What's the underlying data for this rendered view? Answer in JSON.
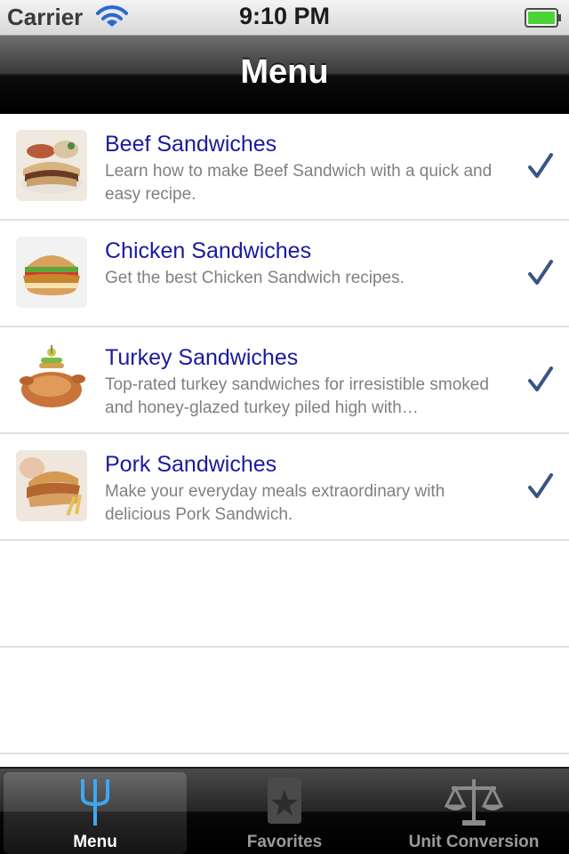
{
  "status_bar": {
    "carrier": "Carrier",
    "time": "9:10 PM"
  },
  "nav_bar": {
    "title": "Menu"
  },
  "items": [
    {
      "title": "Beef Sandwiches",
      "subtitle": "Learn how to make Beef Sandwich with a quick and easy recipe."
    },
    {
      "title": "Chicken Sandwiches",
      "subtitle": "Get the best Chicken Sandwich recipes."
    },
    {
      "title": "Turkey Sandwiches",
      "subtitle": "Top-rated turkey sandwiches for irresistible smoked and honey-glazed turkey piled high with…"
    },
    {
      "title": "Pork Sandwiches",
      "subtitle": "Make your everyday meals extraordinary with delicious Pork Sandwich."
    }
  ],
  "tabs": [
    {
      "label": "Menu",
      "icon": "fork-icon",
      "selected": true
    },
    {
      "label": "Favorites",
      "icon": "star-icon",
      "selected": false
    },
    {
      "label": "Unit Conversion",
      "icon": "scale-icon",
      "selected": false
    }
  ],
  "colors": {
    "title": "#1a1aa0",
    "subtitle": "#808080",
    "checkmark": "#3b5384",
    "tab_selected": "#ffffff"
  }
}
